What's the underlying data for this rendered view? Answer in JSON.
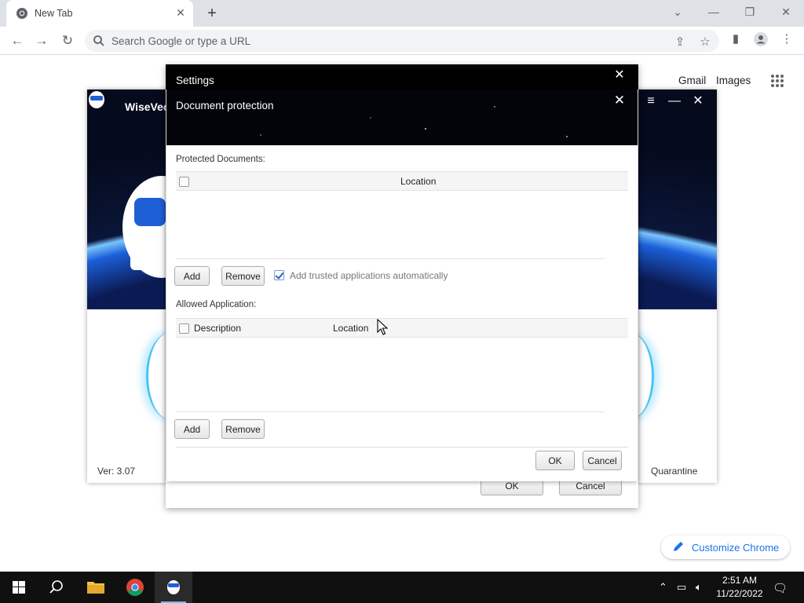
{
  "browser": {
    "tab_title": "New Tab",
    "omnibox_placeholder": "Search Google or type a URL",
    "links": {
      "gmail": "Gmail",
      "images": "Images"
    },
    "customize_label": "Customize Chrome"
  },
  "wisevector": {
    "title": "WiseVec",
    "version": "Ver: 3.07",
    "quarantine": "Quarantine"
  },
  "settings": {
    "title": "Settings",
    "ok": "OK",
    "cancel": "Cancel"
  },
  "doc_protection": {
    "title": "Document protection",
    "protected_label": "Protected Documents:",
    "protected_grid": {
      "columns": [
        "Location"
      ]
    },
    "add": "Add",
    "remove": "Remove",
    "auto_trust_label": "Add trusted applications automatically",
    "auto_trust_checked": true,
    "allowed_label": "Allowed Application:",
    "allowed_grid": {
      "columns": [
        "Description",
        "Location"
      ]
    },
    "add2": "Add",
    "remove2": "Remove",
    "ok": "OK",
    "cancel": "Cancel"
  },
  "taskbar": {
    "time": "2:51 AM",
    "date": "11/22/2022"
  },
  "colors": {
    "chrome_blue": "#1a73e8",
    "wv_dark": "#050a1c",
    "checkbox_blue": "#2b64b2"
  }
}
